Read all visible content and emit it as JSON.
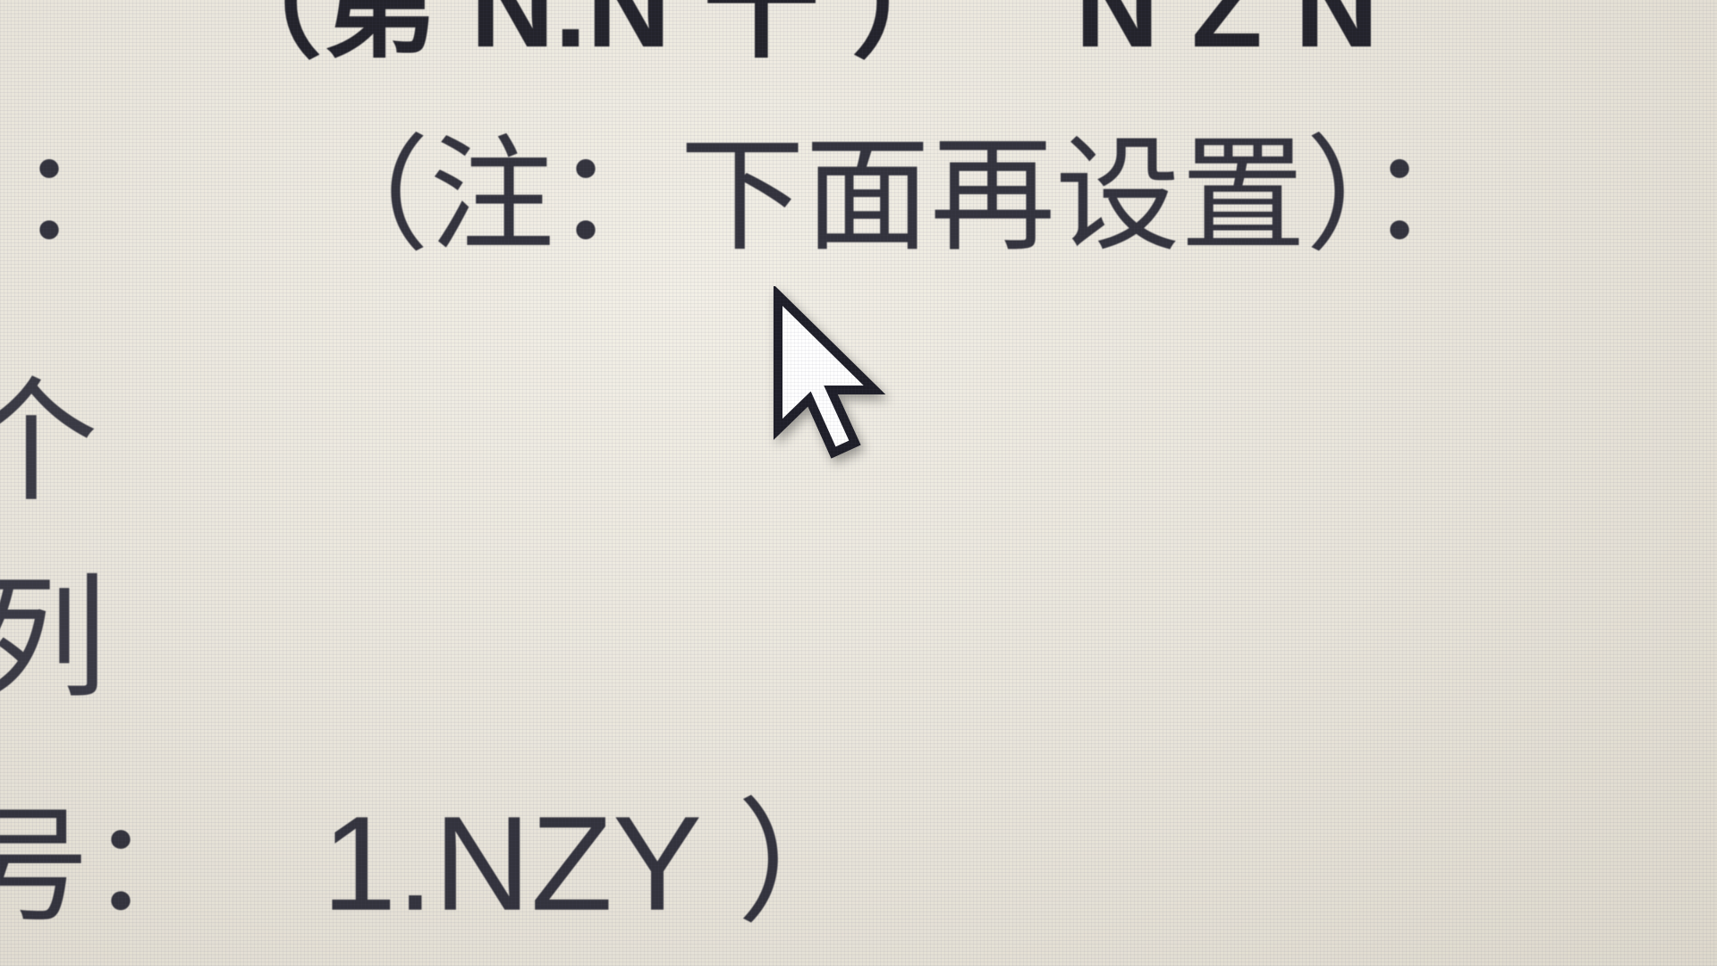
{
  "document": {
    "top_line_left": "（第 N.N 十 ）",
    "top_line_right": "N Z N",
    "note_colon_left": "：",
    "note_text": "（注：下面再设置）",
    "note_colon_right": "：",
    "fragment_1": "个",
    "fragment_2": "列",
    "number_label": "号：",
    "number_value": "1.NZY ）"
  },
  "cursor": {
    "icon": "arrow-pointer-icon"
  },
  "colors": {
    "background": "#e9e6dc",
    "text": "#2a2a30"
  }
}
